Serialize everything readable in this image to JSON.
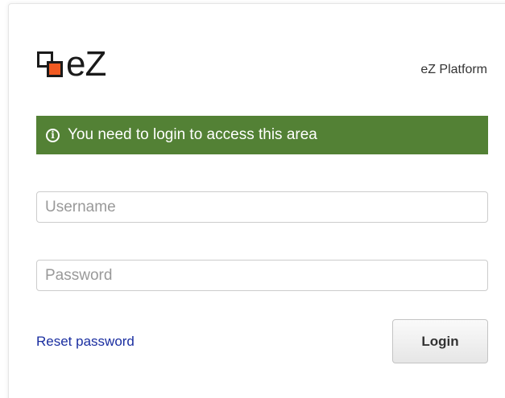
{
  "header": {
    "logo_text": "eZ",
    "product_name": "eZ Platform"
  },
  "alert": {
    "icon": "info-icon",
    "icon_glyph": "i",
    "message": "You need to login to access this area",
    "color": "#538135"
  },
  "form": {
    "username": {
      "placeholder": "Username",
      "value": ""
    },
    "password": {
      "placeholder": "Password",
      "value": ""
    },
    "reset_password_label": "Reset password",
    "login_label": "Login"
  },
  "colors": {
    "logo_accent": "#f15a22",
    "link": "#1a2ea0"
  }
}
